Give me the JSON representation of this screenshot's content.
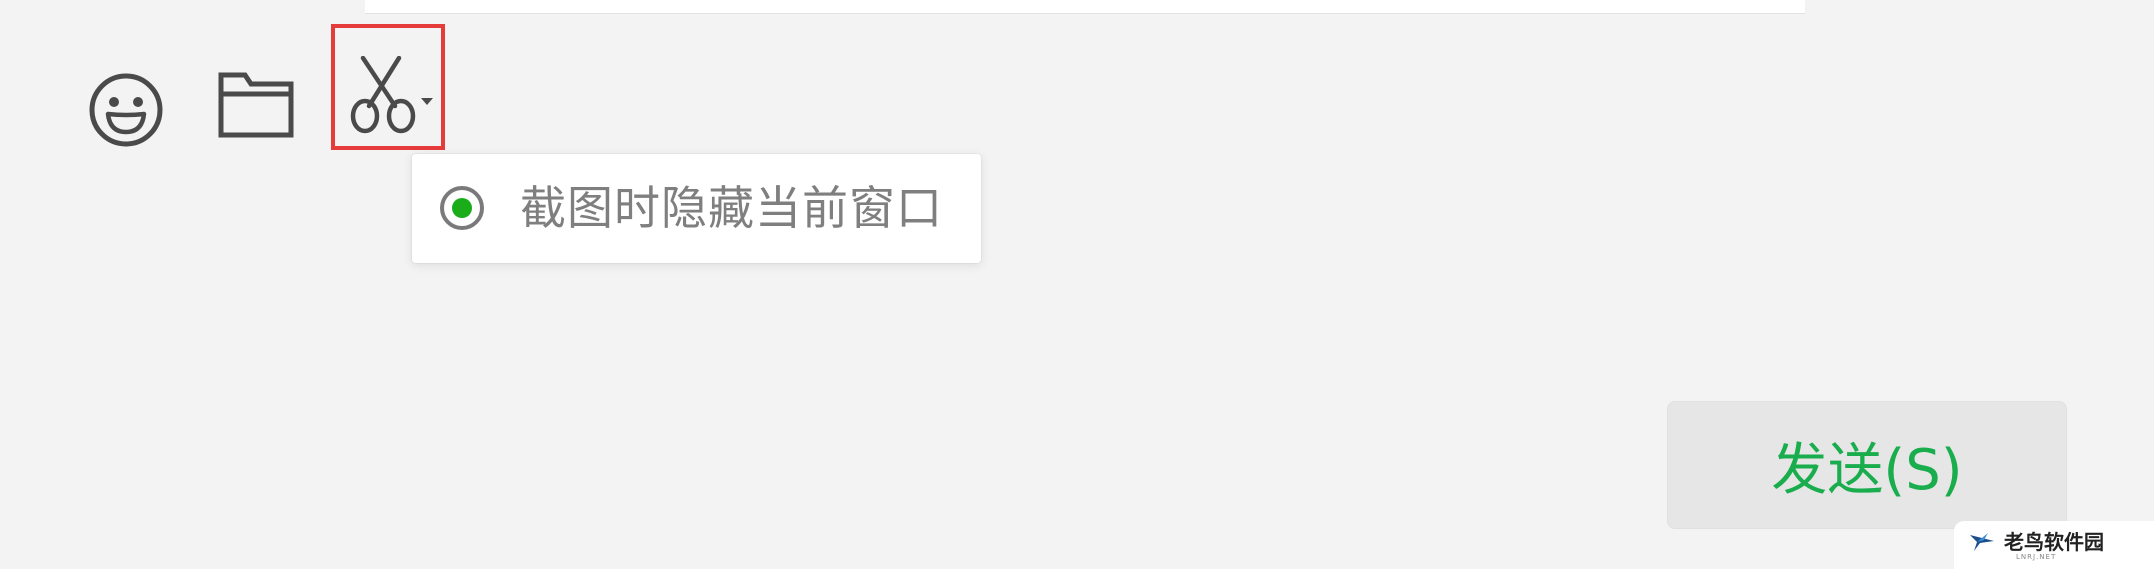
{
  "toolbar": {
    "emoji_icon": "smiley-face-icon",
    "file_icon": "folder-icon",
    "screenshot_icon": "scissors-icon",
    "screenshot_dropdown_icon": "caret-down-icon"
  },
  "screenshot_menu": {
    "option_label": "截图时隐藏当前窗口",
    "option_checked": true
  },
  "send_button": {
    "label": "发送(S)"
  },
  "watermark": {
    "text": "老鸟软件园",
    "subtext": "LNRJ.NET"
  },
  "colors": {
    "highlight_border": "#e53b3b",
    "accent_green": "#1aad19",
    "send_text": "#1aad4e",
    "background": "#f3f3f3"
  }
}
